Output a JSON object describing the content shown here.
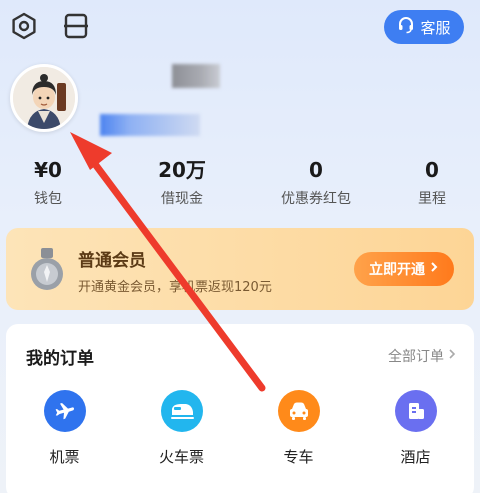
{
  "header": {
    "service_label": "客服",
    "icons": [
      "settings-hexagon-icon",
      "scan-icon",
      "headset-icon"
    ]
  },
  "stats": [
    {
      "value": "¥0",
      "label": "钱包"
    },
    {
      "value": "20万",
      "label": "借现金"
    },
    {
      "value": "0",
      "label": "优惠券红包"
    },
    {
      "value": "0",
      "label": "里程"
    }
  ],
  "membership": {
    "title": "普通会员",
    "subtitle": "开通黄金会员，享机票返现120元",
    "button_label": "立即开通"
  },
  "orders": {
    "title": "我的订单",
    "all_label": "全部订单",
    "items": [
      {
        "label": "机票",
        "icon": "plane-icon",
        "color": "#2f73ee"
      },
      {
        "label": "火车票",
        "icon": "train-icon",
        "color": "#22b6ee"
      },
      {
        "label": "专车",
        "icon": "car-icon",
        "color": "#ff8a1a"
      },
      {
        "label": "酒店",
        "icon": "hotel-icon",
        "color": "#6a6ff0"
      }
    ]
  },
  "colors": {
    "accent": "#3e7ef2",
    "arrow": "#ee3b2c",
    "member_button": "#ff8a2a"
  }
}
